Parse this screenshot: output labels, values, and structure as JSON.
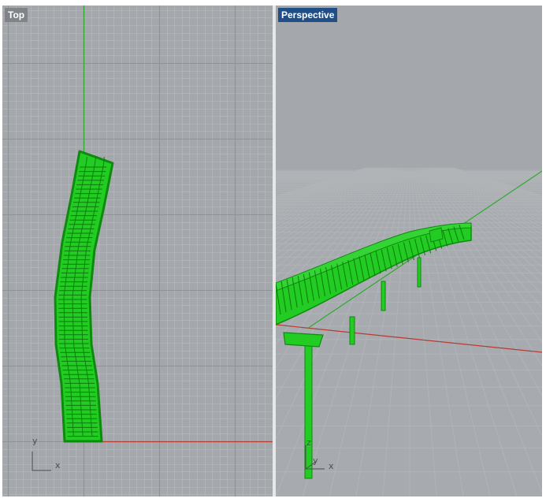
{
  "viewports": {
    "top": {
      "title": "Top"
    },
    "perspective": {
      "title": "Perspective"
    }
  },
  "axes": {
    "top": {
      "x": "x",
      "y": "y"
    },
    "perspective": {
      "x": "x",
      "y": "y",
      "z": "z"
    }
  },
  "colors": {
    "viewport_bg": "#a4a8ac",
    "grid_minor": "#b1b4b7",
    "grid_major": "#8e9296",
    "object_green": "#22cc22",
    "object_outline": "#0e8a0e",
    "x_axis": "#b83a34",
    "y_axis": "#2eaa2e"
  }
}
